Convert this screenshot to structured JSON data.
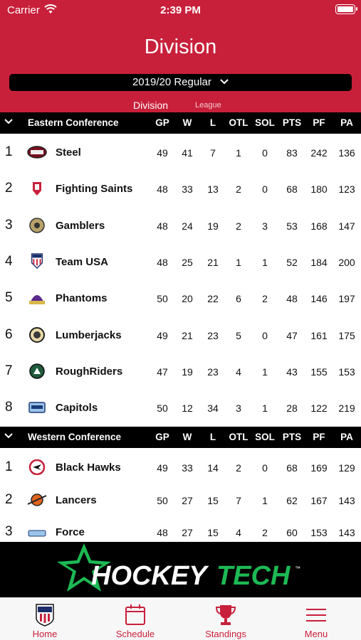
{
  "status": {
    "carrier": "Carrier",
    "time": "2:39 PM"
  },
  "header": {
    "title": "Division",
    "season": "2019/20 Regular",
    "tabs": {
      "division": "Division",
      "league": "League"
    }
  },
  "columns": [
    "GP",
    "W",
    "L",
    "OTL",
    "SOL",
    "PTS",
    "PF",
    "PA"
  ],
  "conferences": [
    {
      "name": "Eastern Conference",
      "teams": [
        {
          "rank": "1",
          "name": "Steel",
          "logo": "steel-logo",
          "stats": [
            "49",
            "41",
            "7",
            "1",
            "0",
            "83",
            "242",
            "136"
          ]
        },
        {
          "rank": "2",
          "name": "Fighting Saints",
          "logo": "fighting-saints-logo",
          "stats": [
            "48",
            "33",
            "13",
            "2",
            "0",
            "68",
            "180",
            "123"
          ]
        },
        {
          "rank": "3",
          "name": "Gamblers",
          "logo": "gamblers-logo",
          "stats": [
            "48",
            "24",
            "19",
            "2",
            "3",
            "53",
            "168",
            "147"
          ]
        },
        {
          "rank": "4",
          "name": "Team USA",
          "logo": "team-usa-logo",
          "stats": [
            "48",
            "25",
            "21",
            "1",
            "1",
            "52",
            "184",
            "200"
          ]
        },
        {
          "rank": "5",
          "name": "Phantoms",
          "logo": "phantoms-logo",
          "stats": [
            "50",
            "20",
            "22",
            "6",
            "2",
            "48",
            "146",
            "197"
          ]
        },
        {
          "rank": "6",
          "name": "Lumberjacks",
          "logo": "lumberjacks-logo",
          "stats": [
            "49",
            "21",
            "23",
            "5",
            "0",
            "47",
            "161",
            "175"
          ]
        },
        {
          "rank": "7",
          "name": "RoughRiders",
          "logo": "roughriders-logo",
          "stats": [
            "47",
            "19",
            "23",
            "4",
            "1",
            "43",
            "155",
            "153"
          ]
        },
        {
          "rank": "8",
          "name": "Capitols",
          "logo": "capitols-logo",
          "stats": [
            "50",
            "12",
            "34",
            "3",
            "1",
            "28",
            "122",
            "219"
          ]
        }
      ]
    },
    {
      "name": "Western Conference",
      "teams": [
        {
          "rank": "1",
          "name": "Black Hawks",
          "logo": "black-hawks-logo",
          "stats": [
            "49",
            "33",
            "14",
            "2",
            "0",
            "68",
            "169",
            "129"
          ]
        },
        {
          "rank": "2",
          "name": "Lancers",
          "logo": "lancers-logo",
          "stats": [
            "50",
            "27",
            "15",
            "7",
            "1",
            "62",
            "167",
            "143"
          ]
        },
        {
          "rank": "3",
          "name": "Force",
          "logo": "force-logo",
          "stats": [
            "48",
            "27",
            "15",
            "4",
            "2",
            "60",
            "153",
            "143"
          ]
        }
      ]
    }
  ],
  "ad": {
    "brand": "HOCKEYTECH",
    "brand_part1": "HOCKEY",
    "brand_part2": "TECH",
    "tm": "™"
  },
  "tabbar": [
    {
      "label": "Home",
      "icon": "usshl-shield-icon"
    },
    {
      "label": "Schedule",
      "icon": "calendar-icon"
    },
    {
      "label": "Standings",
      "icon": "trophy-icon"
    },
    {
      "label": "Menu",
      "icon": "hamburger-menu-icon"
    }
  ],
  "colors": {
    "brand_red": "#c8203b",
    "header_black": "#000000",
    "hockeytech_green": "#1db954"
  }
}
